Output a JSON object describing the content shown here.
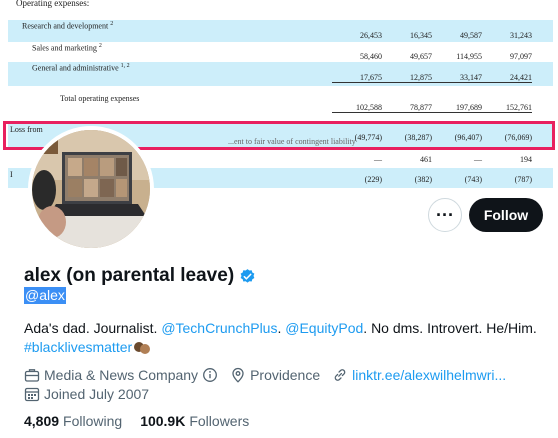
{
  "banner": {
    "heading": "Operating expenses:",
    "rows": [
      {
        "label": "Research and development",
        "sup": "2",
        "values": [
          "26,453",
          "16,345",
          "49,587",
          "31,243"
        ]
      },
      {
        "label": "Sales and marketing",
        "sup": "2",
        "values": [
          "58,460",
          "49,657",
          "114,955",
          "97,097"
        ]
      },
      {
        "label": "General and administrative",
        "sup": "1, 2",
        "values": [
          "17,675",
          "12,875",
          "33,147",
          "24,421"
        ]
      },
      {
        "label": "Total operating expenses",
        "sup": "",
        "values": [
          "102,588",
          "78,877",
          "197,689",
          "152,761"
        ]
      },
      {
        "label": "Loss from",
        "sup": "",
        "values": [
          "(49,774)",
          "(38,287)",
          "(96,407)",
          "(76,069)"
        ]
      },
      {
        "label": "",
        "sup": "",
        "values": [
          "—",
          "461",
          "—",
          "194"
        ]
      },
      {
        "label": "I",
        "sup": "",
        "values": [
          "(229)",
          "(382)",
          "(743)",
          "(787)"
        ]
      }
    ],
    "partial_text": "...ent to fair value of contingent liability"
  },
  "colors": {
    "highlight": "#e8205f",
    "row_fill": "#cdeefa",
    "link": "#1d9bf0",
    "verified": "#1d9bf0",
    "follow_bg": "#0f1419"
  },
  "actions": {
    "more_label": "···",
    "follow_label": "Follow"
  },
  "profile": {
    "display_name": "alex (on parental leave)",
    "handle": "@alex",
    "bio_prefix": "Ada's dad. Journalist. ",
    "bio_link1": "@TechCrunchPlus",
    "bio_mid1": ". ",
    "bio_link2": "@EquityPod",
    "bio_mid2": ". No dms. Introvert. He/Him.",
    "bio_hashtag": "#blacklivesmatter",
    "category": "Media & News Company",
    "location": "Providence",
    "website": "linktr.ee/alexwilhelmwri...",
    "joined": "Joined July 2007",
    "following_count": "4,809",
    "following_label": "Following",
    "followers_count": "100.9K",
    "followers_label": "Followers"
  },
  "icons": {
    "category": "briefcase-icon",
    "info": "info-icon",
    "location": "location-pin-icon",
    "website": "link-icon",
    "joined": "calendar-icon",
    "verified": "verified-badge-icon"
  }
}
